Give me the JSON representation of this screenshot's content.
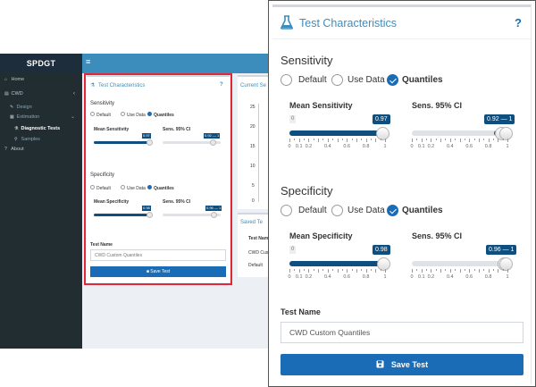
{
  "app": {
    "logo": "SPDGT",
    "menu_toggle": "≡",
    "sidebar": {
      "items": [
        {
          "label": "Home",
          "icon": "home-icon",
          "glyph": "⌂"
        },
        {
          "label": "CWD",
          "icon": "book-icon",
          "glyph": "▤",
          "chevron": "‹"
        },
        {
          "label": "Design",
          "icon": "pencil-icon",
          "glyph": "✎"
        },
        {
          "label": "Estimation",
          "icon": "table-icon",
          "glyph": "▦",
          "chevron": "⌄"
        },
        {
          "label": "Diagnostic Tests",
          "icon": "flask-icon",
          "glyph": "⚗",
          "active": true
        },
        {
          "label": "Samples",
          "icon": "sample-icon",
          "glyph": "⚲"
        },
        {
          "label": "About",
          "icon": "question-icon",
          "glyph": "?"
        }
      ]
    },
    "current_panel_title": "Current Se",
    "saved_panel_title": "Saved Te",
    "saved_table": {
      "header": "Test Nam",
      "rows": [
        "CWD Cus",
        "Default"
      ]
    },
    "chart_y_ticks": [
      "25",
      "20",
      "15",
      "10",
      "5",
      "0"
    ]
  },
  "panel": {
    "title": "Test Characteristics",
    "help": "?",
    "sensitivity": {
      "heading": "Sensitivity",
      "options": [
        {
          "label": "Default",
          "checked": false
        },
        {
          "label": "Use Data",
          "checked": false
        },
        {
          "label": "Quantiles",
          "checked": true
        }
      ],
      "mean_label": "Mean Sensitivity",
      "mean_min": "0",
      "mean_value": 0.97,
      "mean_tag": "0.97",
      "ci_label": "Sens. 95% CI",
      "ci_value": [
        0.92,
        1
      ],
      "ci_tag": "0.92 — 1",
      "ticks": [
        "0",
        "0.1",
        "0.2",
        "0.4",
        "0.6",
        "0.8",
        "1"
      ]
    },
    "specificity": {
      "heading": "Specificity",
      "options": [
        {
          "label": "Default",
          "checked": false
        },
        {
          "label": "Use Data",
          "checked": false
        },
        {
          "label": "Quantiles",
          "checked": true
        }
      ],
      "mean_label": "Mean Specificity",
      "mean_min": "0",
      "mean_value": 0.98,
      "mean_tag": "0.98",
      "ci_label": "Sens. 95% CI",
      "ci_value": [
        0.96,
        1
      ],
      "ci_tag": "0.96 — 1",
      "ticks": [
        "0",
        "0.1",
        "0.2",
        "0.4",
        "0.6",
        "0.8",
        "1"
      ]
    },
    "test_name_label": "Test Name",
    "test_name_value": "CWD Custom Quantiles",
    "save_button": "Save Test",
    "save_icon": "floppy-icon",
    "accent": "#3c8dbc",
    "button_color": "#1a6cb6",
    "slider_color": "#0f4f7f",
    "highlight_color": "#e0283b"
  }
}
